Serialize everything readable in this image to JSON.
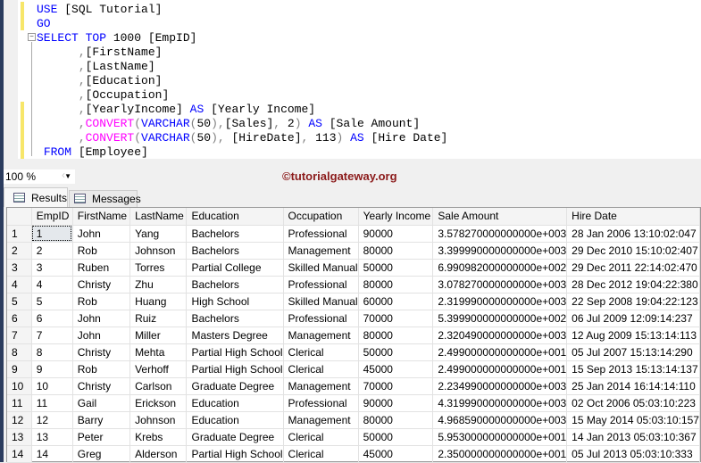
{
  "editor": {
    "lines": [
      [
        [
          "kw",
          "USE "
        ],
        [
          "tx",
          "[SQL Tutorial]"
        ]
      ],
      [
        [
          "kw",
          "GO"
        ]
      ],
      [
        [
          "kw",
          "SELECT TOP "
        ],
        [
          "tx",
          "1000 [EmpID]"
        ]
      ],
      [
        [
          "tx",
          "      "
        ],
        [
          "gr",
          ","
        ],
        [
          "tx",
          "[FirstName]"
        ]
      ],
      [
        [
          "tx",
          "      "
        ],
        [
          "gr",
          ","
        ],
        [
          "tx",
          "[LastName]"
        ]
      ],
      [
        [
          "tx",
          "      "
        ],
        [
          "gr",
          ","
        ],
        [
          "tx",
          "[Education]"
        ]
      ],
      [
        [
          "tx",
          "      "
        ],
        [
          "gr",
          ","
        ],
        [
          "tx",
          "[Occupation]"
        ]
      ],
      [
        [
          "tx",
          "      "
        ],
        [
          "gr",
          ","
        ],
        [
          "tx",
          "[YearlyIncome] "
        ],
        [
          "kw",
          "AS "
        ],
        [
          "tx",
          "[Yearly Income]"
        ]
      ],
      [
        [
          "tx",
          "      "
        ],
        [
          "gr",
          ","
        ],
        [
          "fn",
          "CONVERT"
        ],
        [
          "gr",
          "("
        ],
        [
          "kw",
          "VARCHAR"
        ],
        [
          "gr",
          "("
        ],
        [
          "tx",
          "50"
        ],
        [
          "gr",
          "),"
        ],
        [
          "tx",
          "[Sales]"
        ],
        [
          "gr",
          ", "
        ],
        [
          "tx",
          "2"
        ],
        [
          "gr",
          ") "
        ],
        [
          "kw",
          "AS "
        ],
        [
          "tx",
          "[Sale Amount]"
        ]
      ],
      [
        [
          "tx",
          "      "
        ],
        [
          "gr",
          ","
        ],
        [
          "fn",
          "CONVERT"
        ],
        [
          "gr",
          "("
        ],
        [
          "kw",
          "VARCHAR"
        ],
        [
          "gr",
          "("
        ],
        [
          "tx",
          "50"
        ],
        [
          "gr",
          "), "
        ],
        [
          "tx",
          "[HireDate]"
        ],
        [
          "gr",
          ", "
        ],
        [
          "tx",
          "113"
        ],
        [
          "gr",
          ") "
        ],
        [
          "kw",
          "AS "
        ],
        [
          "tx",
          "[Hire Date]"
        ]
      ],
      [
        [
          "tx",
          " "
        ],
        [
          "kw",
          "FROM "
        ],
        [
          "tx",
          "[Employee]"
        ]
      ]
    ]
  },
  "zoom": {
    "value": "100 %"
  },
  "watermark": "©tutorialgateway.org",
  "tabs": {
    "results": "Results",
    "messages": "Messages"
  },
  "grid": {
    "columns": [
      "",
      "EmpID",
      "FirstName",
      "LastName",
      "Education",
      "Occupation",
      "Yearly Income",
      "Sale Amount",
      "Hire Date"
    ],
    "rows": [
      [
        "1",
        "1",
        "John",
        "Yang",
        "Bachelors",
        "Professional",
        "90000",
        "3.578270000000000e+003",
        "28 Jan 2006 13:10:02:047"
      ],
      [
        "2",
        "2",
        "Rob",
        "Johnson",
        "Bachelors",
        "Management",
        "80000",
        "3.399990000000000e+003",
        "29 Dec 2010 15:10:02:407"
      ],
      [
        "3",
        "3",
        "Ruben",
        "Torres",
        "Partial College",
        "Skilled Manual",
        "50000",
        "6.990982000000000e+002",
        "29 Dec 2011 22:14:02:470"
      ],
      [
        "4",
        "4",
        "Christy",
        "Zhu",
        "Bachelors",
        "Professional",
        "80000",
        "3.078270000000000e+003",
        "28 Dec 2012 19:04:22:380"
      ],
      [
        "5",
        "5",
        "Rob",
        "Huang",
        "High School",
        "Skilled Manual",
        "60000",
        "2.319990000000000e+003",
        "22 Sep 2008 19:04:22:123"
      ],
      [
        "6",
        "6",
        "John",
        "Ruiz",
        "Bachelors",
        "Professional",
        "70000",
        "5.399900000000000e+002",
        "06 Jul 2009 12:09:14:237"
      ],
      [
        "7",
        "7",
        "John",
        "Miller",
        "Masters Degree",
        "Management",
        "80000",
        "2.320490000000000e+003",
        "12 Aug 2009 15:13:14:113"
      ],
      [
        "8",
        "8",
        "Christy",
        "Mehta",
        "Partial High School",
        "Clerical",
        "50000",
        "2.499000000000000e+001",
        "05 Jul 2007 15:13:14:290"
      ],
      [
        "9",
        "9",
        "Rob",
        "Verhoff",
        "Partial High School",
        "Clerical",
        "45000",
        "2.499000000000000e+001",
        "15 Sep 2013 15:13:14:137"
      ],
      [
        "10",
        "10",
        "Christy",
        "Carlson",
        "Graduate Degree",
        "Management",
        "70000",
        "2.234990000000000e+003",
        "25 Jan 2014 16:14:14:110"
      ],
      [
        "11",
        "11",
        "Gail",
        "Erickson",
        "Education",
        "Professional",
        "90000",
        "4.319990000000000e+003",
        "02 Oct 2006 05:03:10:223"
      ],
      [
        "12",
        "12",
        "Barry",
        "Johnson",
        "Education",
        "Management",
        "80000",
        "4.968590000000000e+003",
        "15 May 2014 05:03:10:157"
      ],
      [
        "13",
        "13",
        "Peter",
        "Krebs",
        "Graduate Degree",
        "Clerical",
        "50000",
        "5.953000000000000e+001",
        "14 Jan 2013 05:03:10:367"
      ],
      [
        "14",
        "14",
        "Greg",
        "Alderson",
        "Partial High School",
        "Clerical",
        "45000",
        "2.350000000000000e+001",
        "05 Jul 2013 05:03:10:333"
      ]
    ]
  }
}
